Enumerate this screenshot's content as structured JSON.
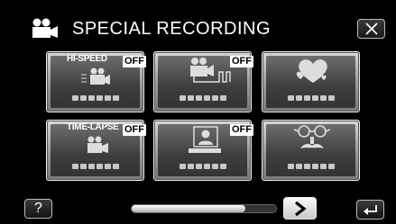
{
  "header": {
    "title": "SPECIAL RECORDING",
    "mode_icon": "video-camera-icon",
    "close_icon": "close-icon"
  },
  "tiles": [
    {
      "label": "HI-SPEED",
      "badge": "OFF",
      "icon": "high-speed-camera-icon"
    },
    {
      "label": "",
      "badge": "OFF",
      "icon": "interval-camera-icon"
    },
    {
      "label": "",
      "badge": "",
      "icon": "hearts-effect-icon"
    },
    {
      "label": "TIME-LAPSE",
      "badge": "OFF",
      "icon": "time-lapse-camera-icon"
    },
    {
      "label": "",
      "badge": "OFF",
      "icon": "self-portrait-icon"
    },
    {
      "label": "",
      "badge": "",
      "icon": "glasses-mustache-effect-icon"
    }
  ],
  "footer": {
    "help_label": "?",
    "next_icon": "chevron-right-icon",
    "back_icon": "return-icon",
    "scroll_position": 0.79
  }
}
